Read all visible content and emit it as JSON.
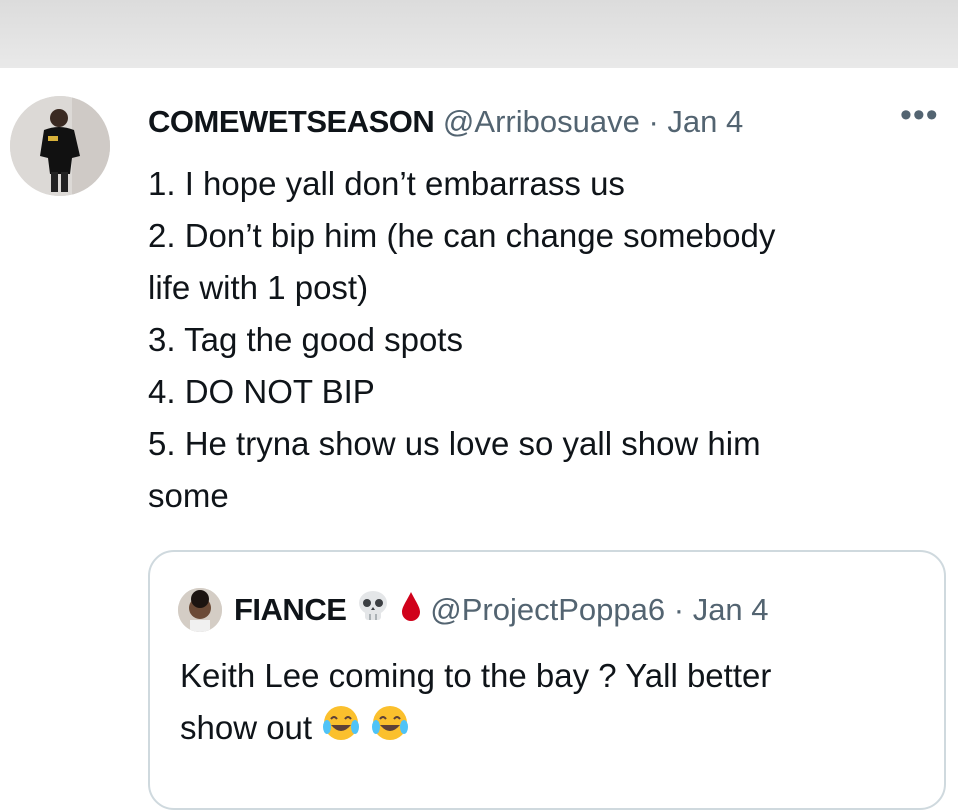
{
  "tweet": {
    "display_name": "COMEWETSEASON",
    "handle": "@Arribosuave",
    "separator": "·",
    "date": "Jan 4",
    "more_label": "•••",
    "lines": [
      "1. I hope yall don’t embarrass us",
      "2. Don’t bip him (he can change somebody",
      "life with 1 post)",
      "3. Tag the good spots",
      "4. DO NOT BIP",
      "5. He tryna show us love so yall show him",
      "some"
    ]
  },
  "quoted_tweet": {
    "display_name": "FIANCE",
    "badges": [
      "skull-emoji",
      "blood-drop-emoji"
    ],
    "handle": "@ProjectPoppa6",
    "separator": "·",
    "date": "Jan 4",
    "lines": [
      "Keith Lee coming to the bay ? Yall better",
      "show out"
    ],
    "trailing_emoji": [
      "tears-of-joy-emoji",
      "tears-of-joy-emoji"
    ]
  }
}
